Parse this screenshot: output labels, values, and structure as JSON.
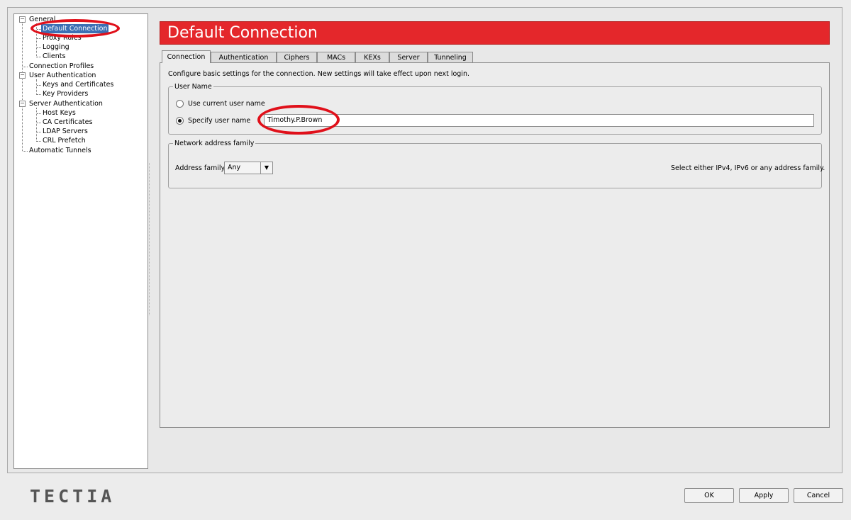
{
  "tree": {
    "items": [
      {
        "label": "General"
      },
      {
        "label": "Default Connection"
      },
      {
        "label": "Proxy Rules"
      },
      {
        "label": "Logging"
      },
      {
        "label": "Clients"
      },
      {
        "label": "Connection Profiles"
      },
      {
        "label": "User Authentication"
      },
      {
        "label": "Keys and Certificates"
      },
      {
        "label": "Key Providers"
      },
      {
        "label": "Server Authentication"
      },
      {
        "label": "Host Keys"
      },
      {
        "label": "CA Certificates"
      },
      {
        "label": "LDAP Servers"
      },
      {
        "label": "CRL Prefetch"
      },
      {
        "label": "Automatic Tunnels"
      }
    ],
    "expander_symbol": "−"
  },
  "header": {
    "title": "Default Connection",
    "color": "#e4272b"
  },
  "tabs": [
    {
      "label": "Connection",
      "active": true
    },
    {
      "label": "Authentication"
    },
    {
      "label": "Ciphers"
    },
    {
      "label": "MACs"
    },
    {
      "label": "KEXs"
    },
    {
      "label": "Server"
    },
    {
      "label": "Tunneling"
    }
  ],
  "connection": {
    "description": "Configure basic settings for the connection. New settings will take effect upon next login.",
    "user_name": {
      "group_title": "User Name",
      "option_current": "Use current user name",
      "option_specify": "Specify user name",
      "selected": "specify",
      "value": "Timothy.P.Brown"
    },
    "network": {
      "group_title": "Network address family",
      "label": "Address family",
      "selected": "Any",
      "arrow": "▼",
      "hint": "Select either IPv4, IPv6 or any address family."
    }
  },
  "footer": {
    "logo": "TECTIA",
    "ok": "OK",
    "apply": "Apply",
    "cancel": "Cancel"
  },
  "annotation_color": "#e0101a"
}
